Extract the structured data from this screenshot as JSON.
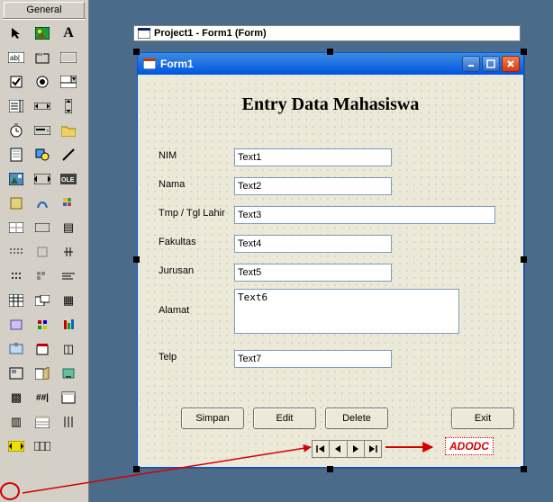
{
  "toolbox": {
    "tab_label": "General",
    "tools": [
      "pointer-icon",
      "picturebox-icon",
      "label-icon",
      "textbox-icon",
      "frame-icon",
      "commandbutton-icon",
      "checkbox-icon",
      "optionbutton-icon",
      "combobox-icon",
      "listbox-icon",
      "hscrollbar-icon",
      "vscrollbar-icon",
      "timer-icon",
      "drivelistbox-icon",
      "dirlistbox-icon",
      "filelistbox-icon",
      "shape-icon",
      "line-icon",
      "image-icon",
      "data-icon",
      "ole-icon",
      "ctl1-icon",
      "ctl2-icon",
      "ctl3-icon",
      "ctl4-icon",
      "ctl5-icon",
      "ctl6-icon",
      "ctl7-icon",
      "ctl8-icon",
      "ctl9-icon",
      "ctl10-icon",
      "ctl11-icon",
      "ctl12-icon",
      "ctl13-icon",
      "ctl14-icon",
      "ctl15-icon",
      "ctl16-icon",
      "ctl17-icon",
      "ctl18-icon",
      "ctl19-icon",
      "ctl20-icon",
      "ctl21-icon",
      "ctl22-icon",
      "ctl23-icon",
      "ctl24-icon",
      "ctl25-icon",
      "ctl26-icon",
      "ctl27-icon",
      "ctl28-icon",
      "ctl29-icon",
      "ctl30-icon",
      "ctl31-icon",
      "ctl32-icon",
      "ctl33-icon",
      "adodc-icon",
      "ctl35-icon"
    ]
  },
  "designer": {
    "caption": "Project1 - Form1 (Form)"
  },
  "form": {
    "caption": "Form1",
    "title": "Entry Data Mahasiswa",
    "labels": {
      "nim": "NIM",
      "nama": "Nama",
      "ttl": "Tmp / Tgl Lahir",
      "fakultas": "Fakultas",
      "jurusan": "Jurusan",
      "alamat": "Alamat",
      "telp": "Telp"
    },
    "values": {
      "nim": "Text1",
      "nama": "Text2",
      "ttl": "Text3",
      "fakultas": "Text4",
      "jurusan": "Text5",
      "alamat": "Text6",
      "telp": "Text7"
    },
    "buttons": {
      "simpan": "Simpan",
      "edit": "Edit",
      "delete": "Delete",
      "exit": "Exit"
    }
  },
  "annotation": {
    "adodc": "ADODC"
  }
}
